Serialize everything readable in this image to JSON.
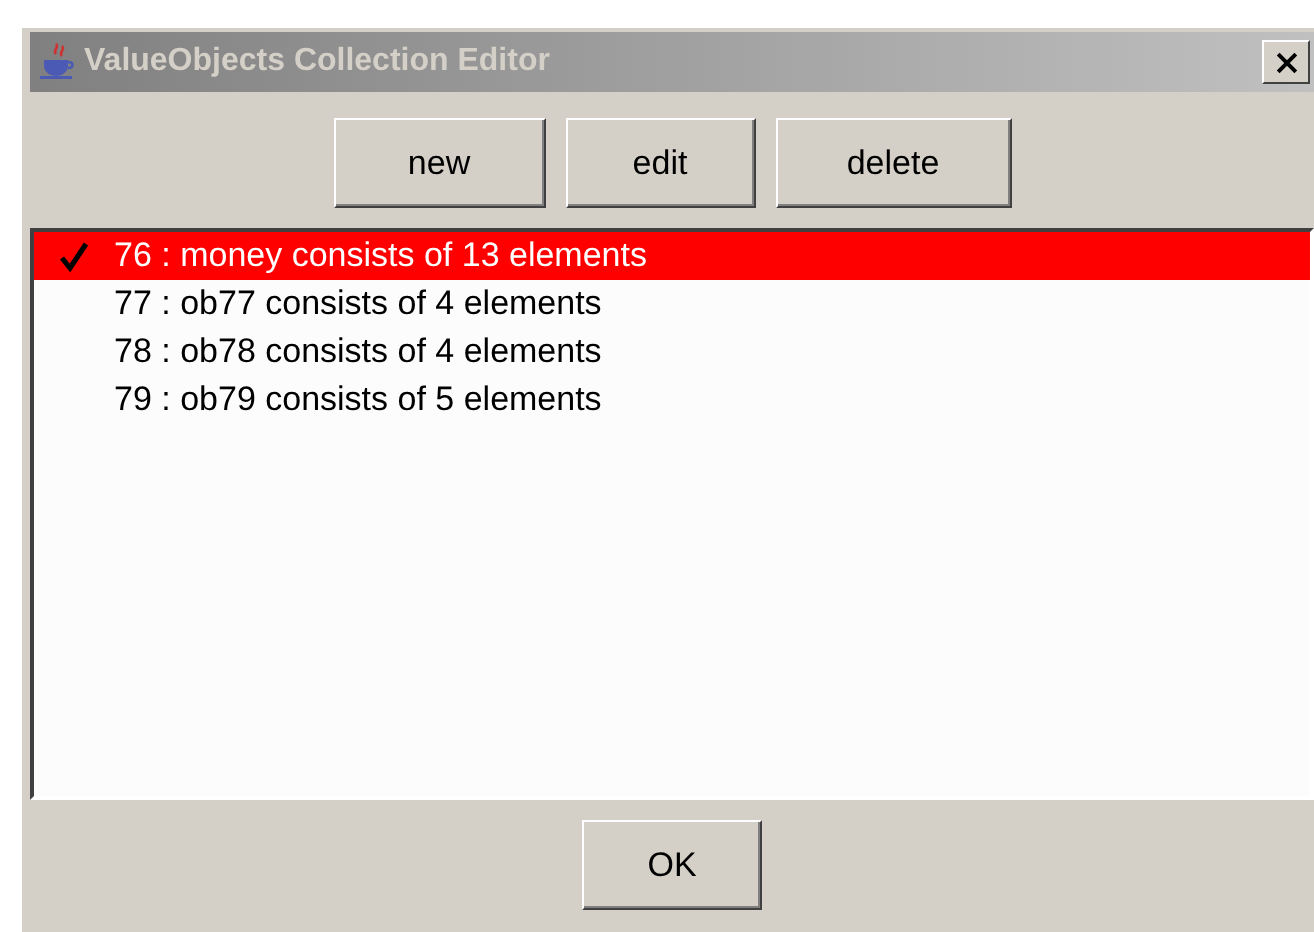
{
  "window": {
    "title": "ValueObjects Collection Editor"
  },
  "toolbar": [
    "new",
    "edit",
    "delete"
  ],
  "list": [
    {
      "label": "76 : money consists of 13 elements",
      "selected": true
    },
    {
      "label": "77 : ob77 consists of 4 elements",
      "selected": false
    },
    {
      "label": "78 : ob78 consists of 4 elements",
      "selected": false
    },
    {
      "label": "79 : ob79 consists of 5 elements",
      "selected": false
    }
  ],
  "buttons": [
    "OK"
  ]
}
